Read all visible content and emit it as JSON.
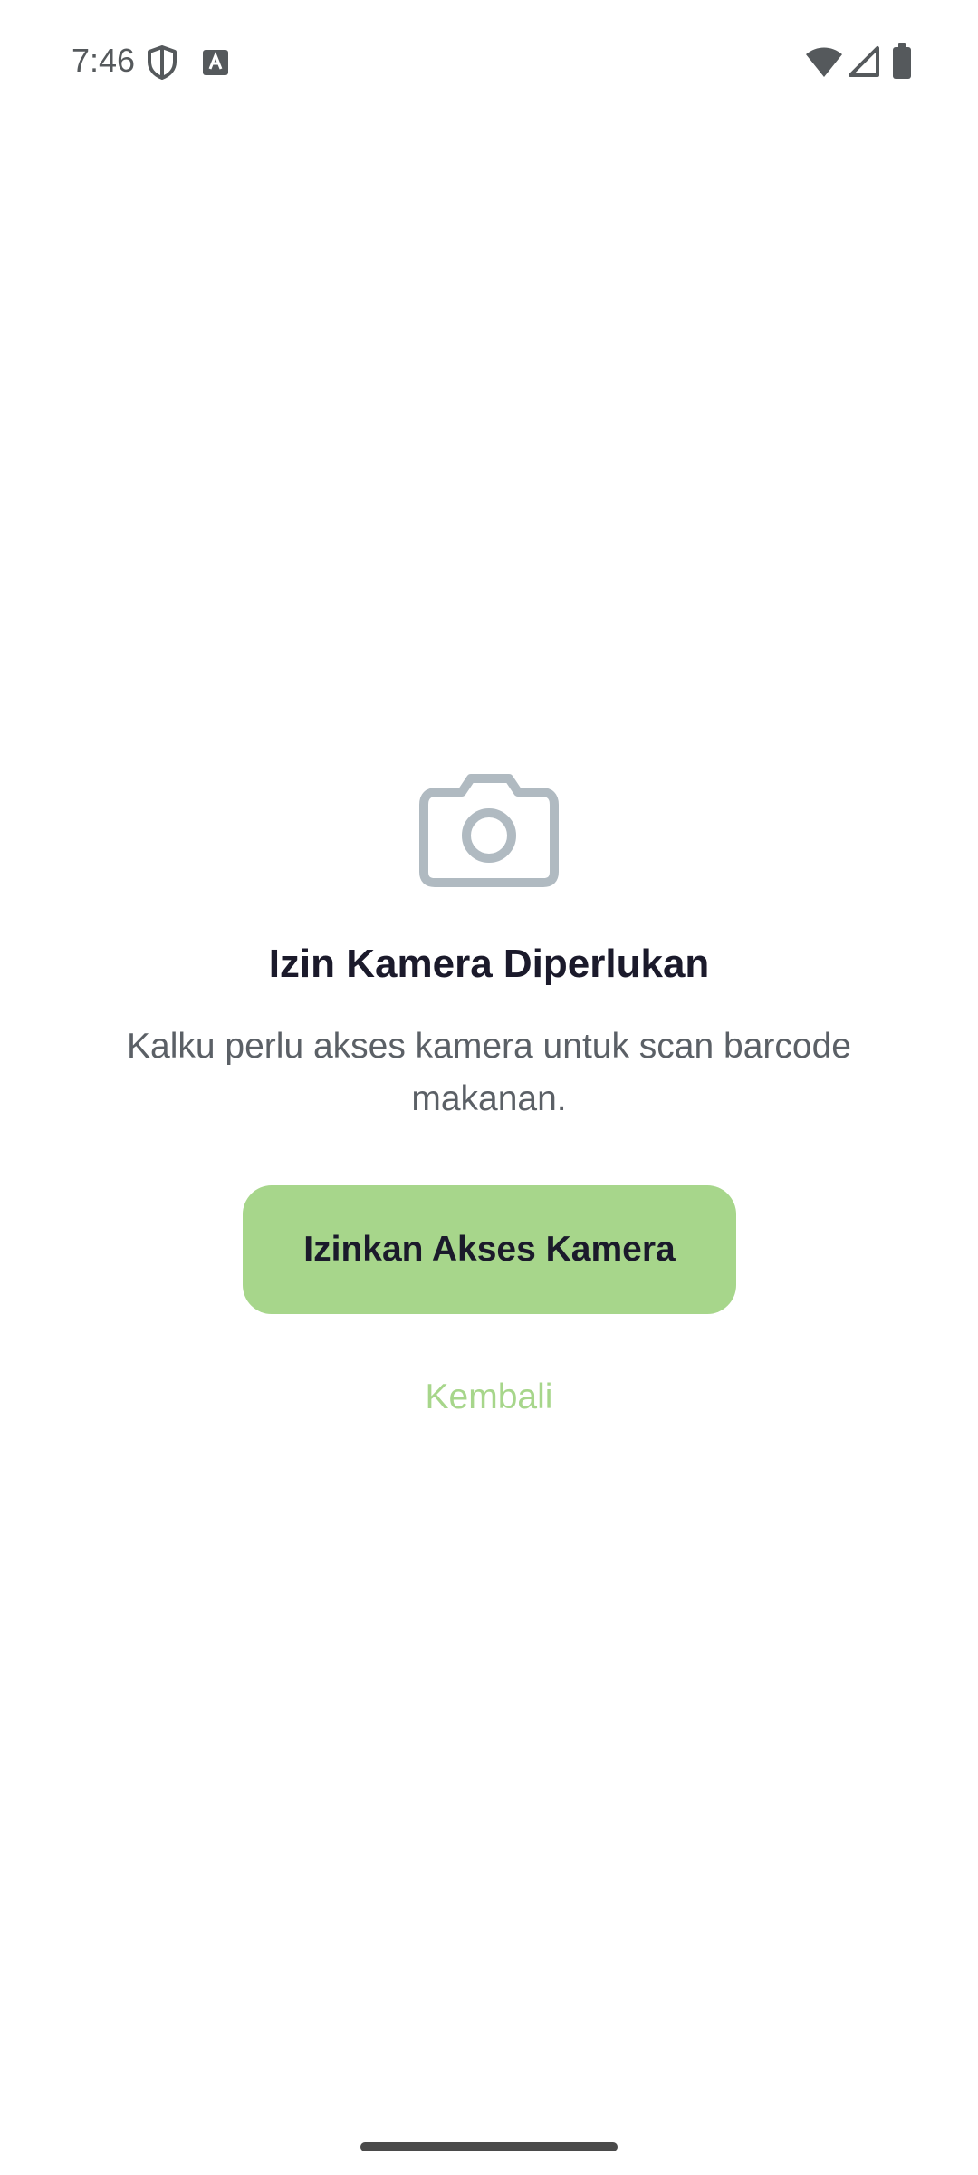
{
  "status_bar": {
    "time": "7:46",
    "icons": [
      "shield-icon",
      "keyboard-icon",
      "wifi-icon",
      "signal-icon",
      "battery-icon"
    ]
  },
  "permission": {
    "icon": "camera-icon",
    "title": "Izin Kamera Diperlukan",
    "description": "Kalku perlu akses kamera untuk scan barcode makanan.",
    "allow_button_label": "Izinkan Akses Kamera",
    "back_label": "Kembali"
  },
  "colors": {
    "accent": "#a7d68b",
    "title": "#1b1a2b",
    "body_text": "#5b6066",
    "icon_gray": "#b0bac1"
  }
}
